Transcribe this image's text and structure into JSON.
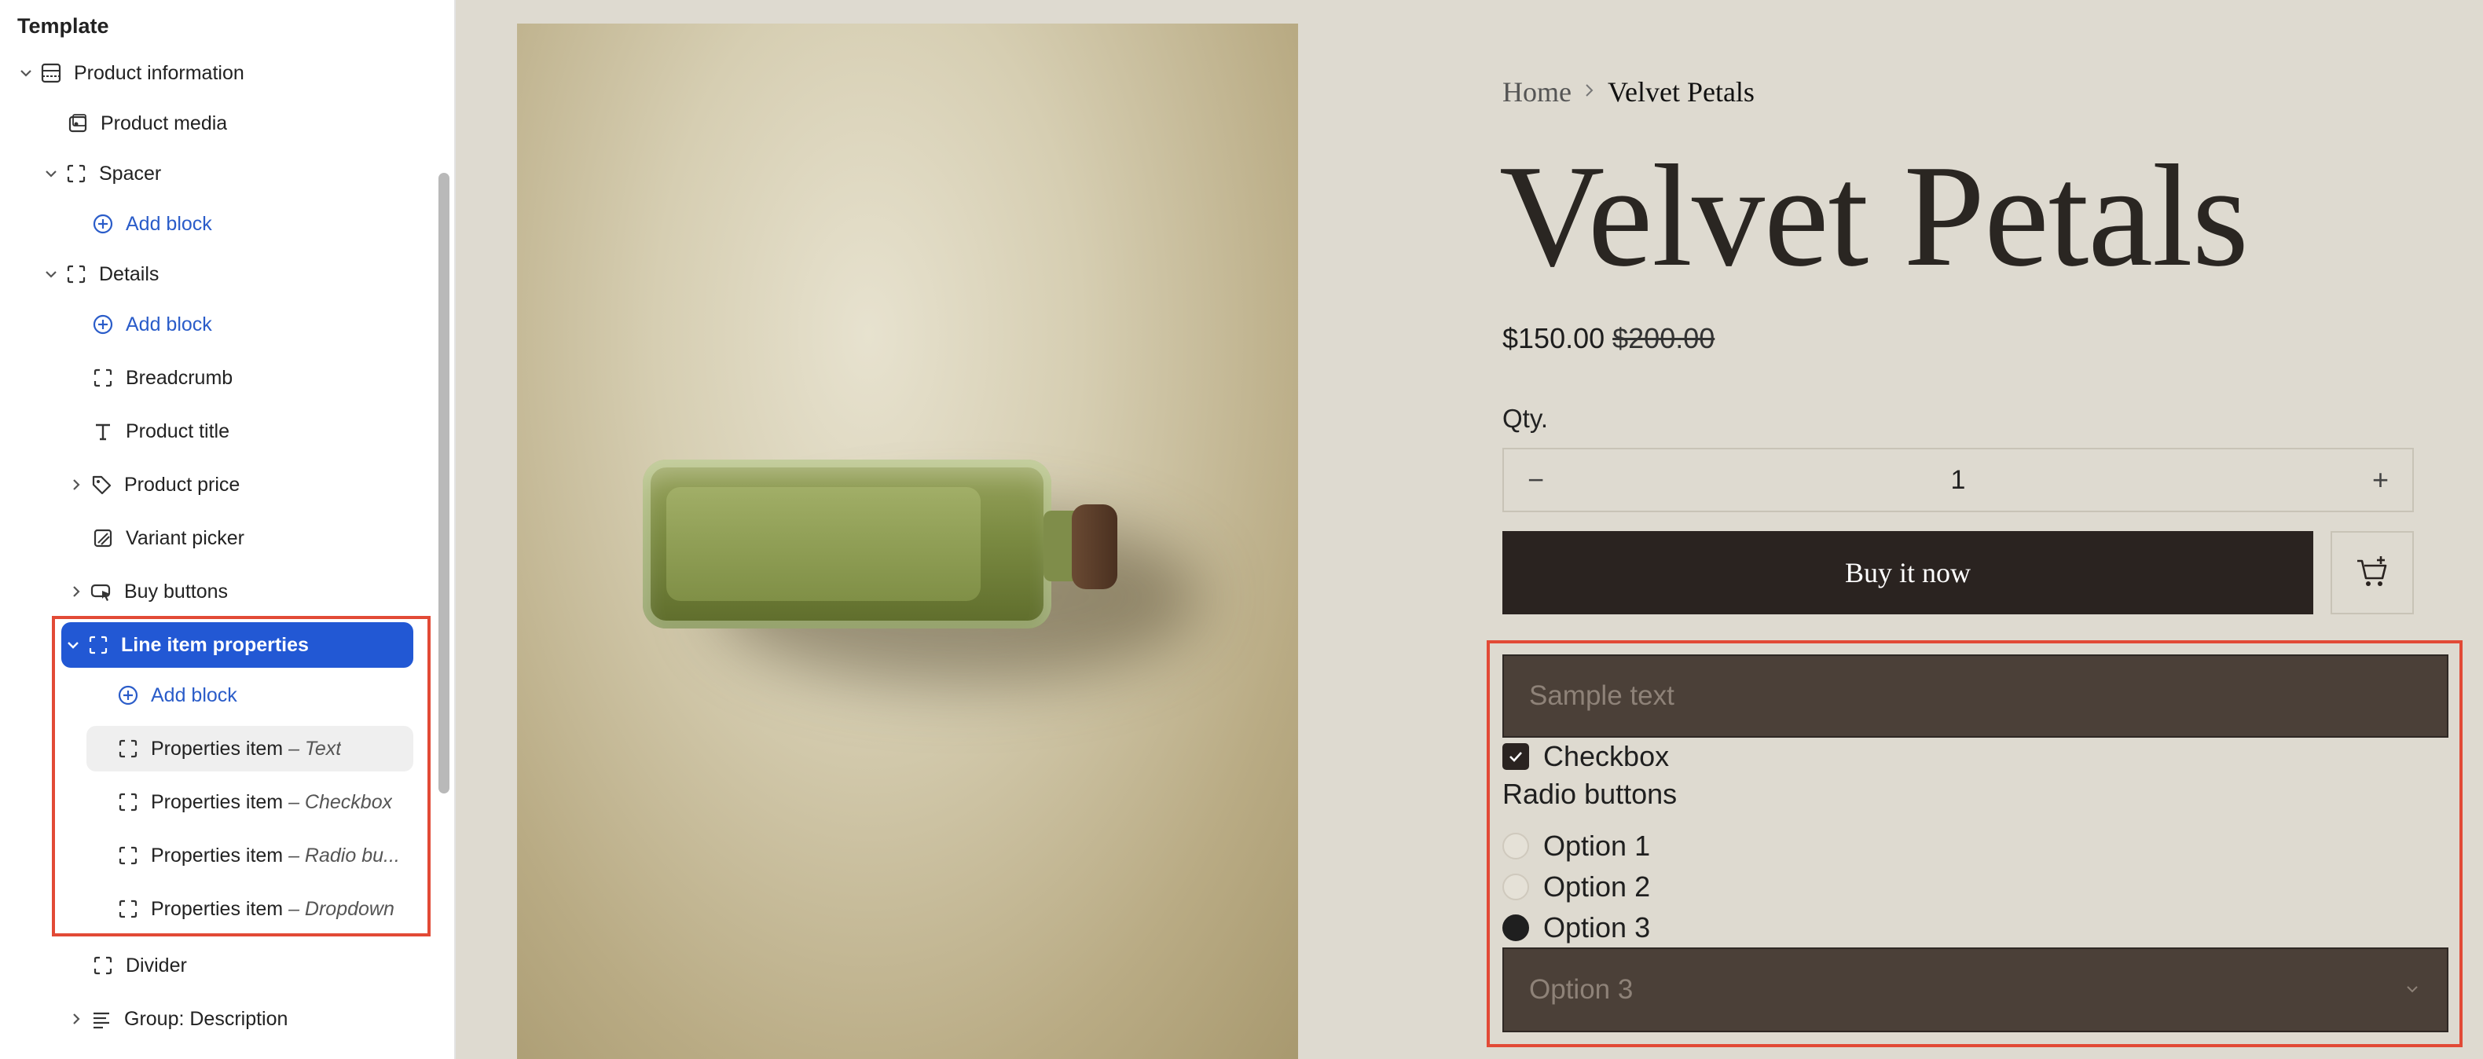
{
  "sidebar": {
    "title": "Template",
    "items": [
      {
        "label": "Product information"
      },
      {
        "label": "Product media"
      },
      {
        "label": "Spacer"
      },
      {
        "label": "Add block"
      },
      {
        "label": "Details"
      },
      {
        "label": "Add block"
      },
      {
        "label": "Breadcrumb"
      },
      {
        "label": "Product title"
      },
      {
        "label": "Product price"
      },
      {
        "label": "Variant picker"
      },
      {
        "label": "Buy buttons"
      },
      {
        "label": "Line item properties"
      },
      {
        "label": "Add block"
      },
      {
        "label": "Properties item",
        "suffix": "– Text"
      },
      {
        "label": "Properties item",
        "suffix": "– Checkbox"
      },
      {
        "label": "Properties item",
        "suffix": "– Radio bu..."
      },
      {
        "label": "Properties item",
        "suffix": "– Dropdown"
      },
      {
        "label": "Divider"
      },
      {
        "label": "Group: Description"
      }
    ]
  },
  "product": {
    "breadcrumb_home": "Home",
    "breadcrumb_current": "Velvet Petals",
    "title": "Velvet Petals",
    "price": "$150.00",
    "compare_price": "$200.00",
    "qty_label": "Qty.",
    "qty_value": "1",
    "qty_minus": "−",
    "qty_plus": "+",
    "buy_label": "Buy it now",
    "text_placeholder": "Sample text",
    "checkbox_label": "Checkbox",
    "radio_title": "Radio buttons",
    "radio_options": [
      "Option 1",
      "Option 2",
      "Option 3"
    ],
    "radio_selected": "Option 3",
    "dropdown_value": "Option 3"
  },
  "colors": {
    "accent": "#2258d4",
    "highlight": "#e24a36",
    "page_bg": "#dedad0",
    "button_dark": "#2a2320"
  }
}
